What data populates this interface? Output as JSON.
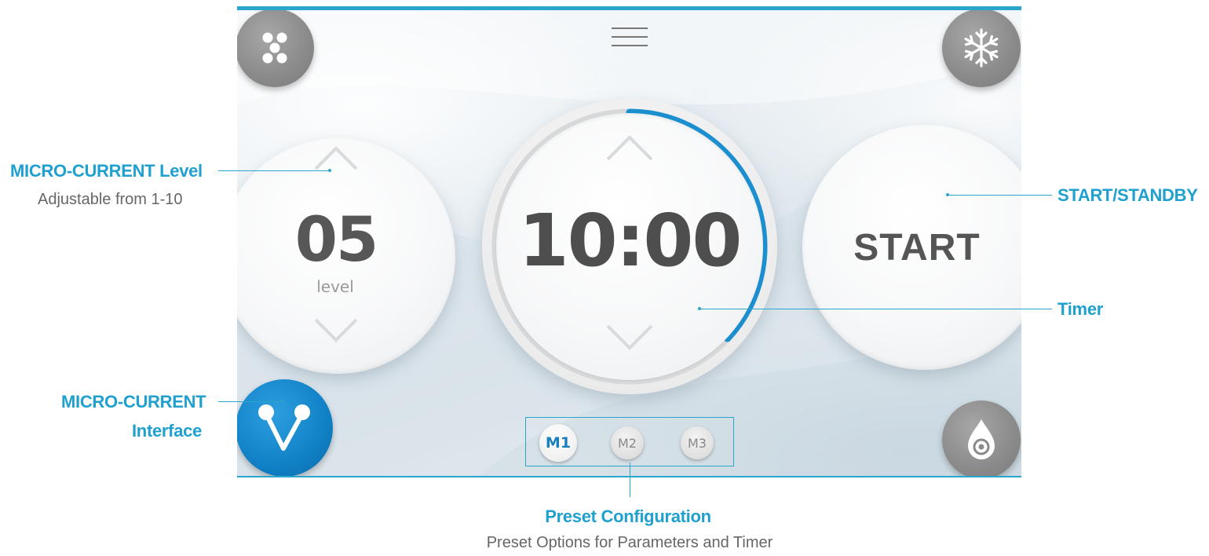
{
  "screen": {
    "level": {
      "value": "05",
      "unit": "level"
    },
    "timer": {
      "value": "10:00",
      "progress": 0.37
    },
    "start_label": "START",
    "presets": [
      {
        "label": "M1",
        "active": true
      },
      {
        "label": "M2",
        "active": false
      },
      {
        "label": "M3",
        "active": false
      }
    ],
    "icons": {
      "top_left": "dots-icon",
      "top_center": "menu-icon",
      "top_right": "snowflake-icon",
      "bottom_left": "micro-current-icon",
      "bottom_right": "water-drop-icon"
    },
    "colors": {
      "accent": "#2aa5cc",
      "timer_arc": "#1b8fd0",
      "mc_button": "#1181c6",
      "grey_button": "#8a8a8a"
    }
  },
  "annotations": {
    "level": {
      "title": "MICRO-CURRENT Level",
      "subtitle": "Adjustable from 1-10"
    },
    "interface": {
      "line1": "MICRO-CURRENT",
      "line2": "Interface"
    },
    "start": {
      "title": "START/STANDBY"
    },
    "timer": {
      "title": "Timer"
    },
    "preset": {
      "title": "Preset Configuration",
      "subtitle": "Preset Options for Parameters and Timer"
    }
  }
}
